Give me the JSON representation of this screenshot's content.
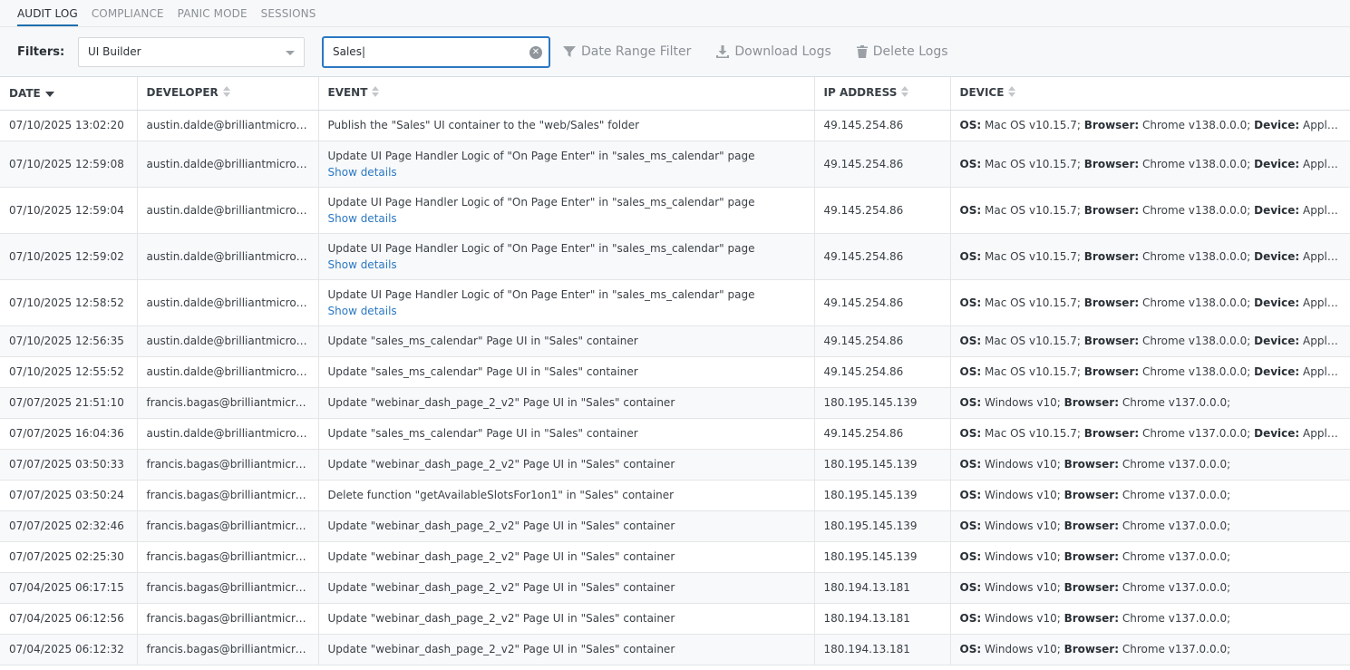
{
  "tabs": [
    "AUDIT LOG",
    "COMPLIANCE",
    "PANIC MODE",
    "SESSIONS"
  ],
  "filters": {
    "label": "Filters:",
    "source_select": "UI Builder",
    "search_value": "Sales|",
    "date_range": "Date Range Filter",
    "download": "Download Logs",
    "delete": "Delete Logs"
  },
  "columns": [
    "DATE",
    "DEVELOPER",
    "EVENT",
    "IP ADDRESS",
    "DEVICE"
  ],
  "show_details_label": "Show details",
  "device_keys": {
    "os": "OS:",
    "browser": "Browser:",
    "device": "Device:"
  },
  "rows": [
    {
      "date": "07/10/2025 13:02:20",
      "developer": "austin.dalde@brilliantmicrosc...",
      "event": "Publish the \"Sales\" UI container to the \"web/Sales\" folder",
      "details": false,
      "ip": "49.145.254.86",
      "os": "Mac OS v10.15.7;",
      "browser": "Chrome v138.0.0.0;",
      "device": "Apple Macintosh; Ty"
    },
    {
      "date": "07/10/2025 12:59:08",
      "developer": "austin.dalde@brilliantmicrosc...",
      "event": "Update UI Page Handler Logic of \"On Page Enter\" in \"sales_ms_calendar\" page",
      "details": true,
      "ip": "49.145.254.86",
      "os": "Mac OS v10.15.7;",
      "browser": "Chrome v138.0.0.0;",
      "device": "Apple Macintosh; Ty"
    },
    {
      "date": "07/10/2025 12:59:04",
      "developer": "austin.dalde@brilliantmicrosc...",
      "event": "Update UI Page Handler Logic of \"On Page Enter\" in \"sales_ms_calendar\" page",
      "details": true,
      "ip": "49.145.254.86",
      "os": "Mac OS v10.15.7;",
      "browser": "Chrome v138.0.0.0;",
      "device": "Apple Macintosh; Ty"
    },
    {
      "date": "07/10/2025 12:59:02",
      "developer": "austin.dalde@brilliantmicrosc...",
      "event": "Update UI Page Handler Logic of \"On Page Enter\" in \"sales_ms_calendar\" page",
      "details": true,
      "ip": "49.145.254.86",
      "os": "Mac OS v10.15.7;",
      "browser": "Chrome v138.0.0.0;",
      "device": "Apple Macintosh; Ty"
    },
    {
      "date": "07/10/2025 12:58:52",
      "developer": "austin.dalde@brilliantmicrosc...",
      "event": "Update UI Page Handler Logic of \"On Page Enter\" in \"sales_ms_calendar\" page",
      "details": true,
      "ip": "49.145.254.86",
      "os": "Mac OS v10.15.7;",
      "browser": "Chrome v138.0.0.0;",
      "device": "Apple Macintosh; Ty"
    },
    {
      "date": "07/10/2025 12:56:35",
      "developer": "austin.dalde@brilliantmicrosc...",
      "event": "Update \"sales_ms_calendar\" Page UI in \"Sales\" container",
      "details": false,
      "ip": "49.145.254.86",
      "os": "Mac OS v10.15.7;",
      "browser": "Chrome v138.0.0.0;",
      "device": "Apple Macintosh; Ty"
    },
    {
      "date": "07/10/2025 12:55:52",
      "developer": "austin.dalde@brilliantmicrosc...",
      "event": "Update \"sales_ms_calendar\" Page UI in \"Sales\" container",
      "details": false,
      "ip": "49.145.254.86",
      "os": "Mac OS v10.15.7;",
      "browser": "Chrome v138.0.0.0;",
      "device": "Apple Macintosh; Ty"
    },
    {
      "date": "07/07/2025 21:51:10",
      "developer": "francis.bagas@brilliantmicrosc...",
      "event": "Update \"webinar_dash_page_2_v2\" Page UI in \"Sales\" container",
      "details": false,
      "ip": "180.195.145.139",
      "os": "Windows v10;",
      "browser": "Chrome v137.0.0.0;",
      "device": ""
    },
    {
      "date": "07/07/2025 16:04:36",
      "developer": "austin.dalde@brilliantmicrosc...",
      "event": "Update \"sales_ms_calendar\" Page UI in \"Sales\" container",
      "details": false,
      "ip": "49.145.254.86",
      "os": "Mac OS v10.15.7;",
      "browser": "Chrome v137.0.0.0;",
      "device": "Apple Macintosh; Ty"
    },
    {
      "date": "07/07/2025 03:50:33",
      "developer": "francis.bagas@brilliantmicrosc...",
      "event": "Update \"webinar_dash_page_2_v2\" Page UI in \"Sales\" container",
      "details": false,
      "ip": "180.195.145.139",
      "os": "Windows v10;",
      "browser": "Chrome v137.0.0.0;",
      "device": ""
    },
    {
      "date": "07/07/2025 03:50:24",
      "developer": "francis.bagas@brilliantmicrosc...",
      "event": "Delete function \"getAvailableSlotsFor1on1\" in \"Sales\" container",
      "details": false,
      "ip": "180.195.145.139",
      "os": "Windows v10;",
      "browser": "Chrome v137.0.0.0;",
      "device": ""
    },
    {
      "date": "07/07/2025 02:32:46",
      "developer": "francis.bagas@brilliantmicrosc...",
      "event": "Update \"webinar_dash_page_2_v2\" Page UI in \"Sales\" container",
      "details": false,
      "ip": "180.195.145.139",
      "os": "Windows v10;",
      "browser": "Chrome v137.0.0.0;",
      "device": ""
    },
    {
      "date": "07/07/2025 02:25:30",
      "developer": "francis.bagas@brilliantmicrosc...",
      "event": "Update \"webinar_dash_page_2_v2\" Page UI in \"Sales\" container",
      "details": false,
      "ip": "180.195.145.139",
      "os": "Windows v10;",
      "browser": "Chrome v137.0.0.0;",
      "device": ""
    },
    {
      "date": "07/04/2025 06:17:15",
      "developer": "francis.bagas@brilliantmicrosc...",
      "event": "Update \"webinar_dash_page_2_v2\" Page UI in \"Sales\" container",
      "details": false,
      "ip": "180.194.13.181",
      "os": "Windows v10;",
      "browser": "Chrome v137.0.0.0;",
      "device": ""
    },
    {
      "date": "07/04/2025 06:12:56",
      "developer": "francis.bagas@brilliantmicrosc...",
      "event": "Update \"webinar_dash_page_2_v2\" Page UI in \"Sales\" container",
      "details": false,
      "ip": "180.194.13.181",
      "os": "Windows v10;",
      "browser": "Chrome v137.0.0.0;",
      "device": ""
    },
    {
      "date": "07/04/2025 06:12:32",
      "developer": "francis.bagas@brilliantmicrosc...",
      "event": "Update \"webinar_dash_page_2_v2\" Page UI in \"Sales\" container",
      "details": false,
      "ip": "180.194.13.181",
      "os": "Windows v10;",
      "browser": "Chrome v137.0.0.0;",
      "device": ""
    }
  ]
}
